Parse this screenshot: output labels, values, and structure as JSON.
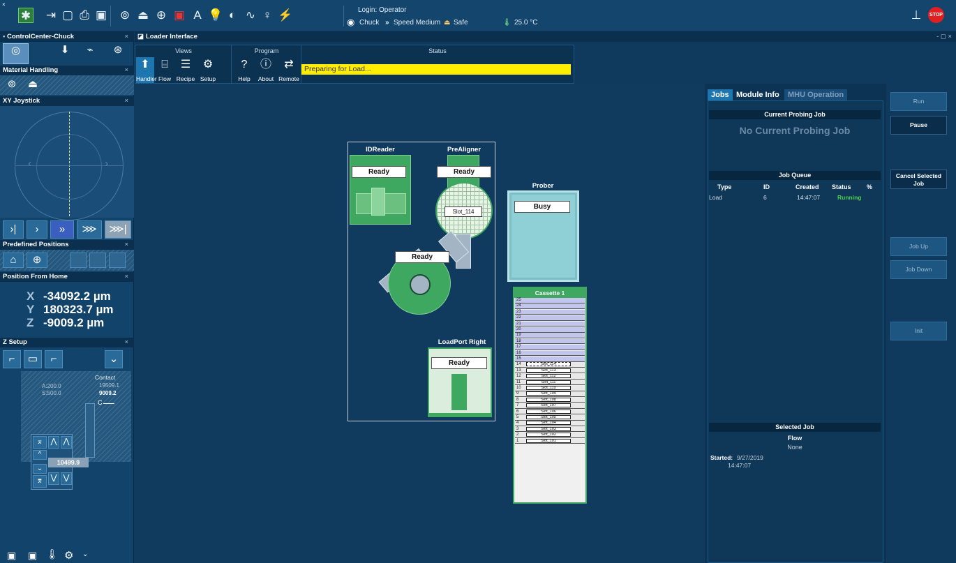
{
  "toolbar": {
    "login": "Login: Operator",
    "chuck": "Chuck",
    "speed": "Speed Medium",
    "safe": "Safe",
    "temp": "25.0 °C",
    "stop": "STOP"
  },
  "left": {
    "control_center": "ControlCenter-Chuck",
    "material_handling": "Material Handling",
    "xy_joystick": "XY Joystick",
    "predefined_positions": "Predefined Positions",
    "position_from_home": "Position From Home",
    "x_label": "X",
    "x_value": "-34092.2 µm",
    "y_label": "Y",
    "y_value": "180323.7 µm",
    "z_label": "Z",
    "z_value": "-9009.2 µm",
    "z_setup": "Z Setup",
    "contact_label": "Contact",
    "contact_val1": "19509.1",
    "contact_val2": "9009.2",
    "a_val": "A:200.0",
    "s_val": "S:500.0",
    "c_label": "C",
    "z_height": "10499.9",
    "close": "×"
  },
  "loader": {
    "title": "Loader Interface",
    "views": "Views",
    "program": "Program",
    "status_title": "Status",
    "handler": "Handler",
    "flow": "Flow",
    "recipe": "Recipe",
    "setup": "Setup",
    "help": "Help",
    "about": "About",
    "remote": "Remote",
    "status_text": "Preparing for Load...",
    "win_controls": "- ◻ ×"
  },
  "canvas": {
    "idreader": "IDReader",
    "idreader_state": "Ready",
    "prealigner": "PreAligner",
    "prealigner_state": "Ready",
    "prealigner_slot": "Slot_114",
    "robot_state": "Ready",
    "prober": "Prober",
    "prober_state": "Busy",
    "loadport": "LoadPort Right",
    "loadport_state": "Ready",
    "cassette": "Cassette 1",
    "empty_rows": [
      "25",
      "24",
      "23",
      "22",
      "21",
      "20",
      "19",
      "18",
      "17",
      "16",
      "15"
    ],
    "slot_rows": [
      {
        "n": "14",
        "s": "Slot_114"
      },
      {
        "n": "13",
        "s": "Slot_113"
      },
      {
        "n": "12",
        "s": "Slot_112"
      },
      {
        "n": "11",
        "s": "Slot_111"
      },
      {
        "n": "10",
        "s": "Slot_110"
      },
      {
        "n": "9",
        "s": "Slot_109"
      },
      {
        "n": "8",
        "s": "Slot_108"
      },
      {
        "n": "7",
        "s": "Slot_107"
      },
      {
        "n": "6",
        "s": "Slot_106"
      },
      {
        "n": "5",
        "s": "Slot_105"
      },
      {
        "n": "4",
        "s": "Slot_104"
      },
      {
        "n": "3",
        "s": "Slot_103"
      },
      {
        "n": "2",
        "s": "Slot_102"
      },
      {
        "n": "1",
        "s": "Slot_101"
      }
    ]
  },
  "jobs": {
    "tab_jobs": "Jobs",
    "tab_module": "Module Info",
    "tab_mhu": "MHU Operation",
    "current_head": "Current Probing Job",
    "no_job": "No Current Probing Job",
    "queue_head": "Job Queue",
    "col_type": "Type",
    "col_id": "ID",
    "col_created": "Created",
    "col_status": "Status",
    "col_pct": "%",
    "row_type": "Load",
    "row_id": "6",
    "row_created": "14:47:07",
    "row_status": "Running",
    "selected_head": "Selected Job",
    "flow_label": "Flow",
    "flow_value": "None",
    "started_label": "Started:",
    "started_date": "9/27/2019",
    "started_time": "14:47:07"
  },
  "side_buttons": {
    "run": "Run",
    "pause": "Pause",
    "cancel": "Cancel Selected Job",
    "job_up": "Job Up",
    "job_down": "Job Down",
    "init": "Init"
  },
  "colors": {
    "background": "#0f3a5e",
    "status_yellow": "#ffee00",
    "module_green": "#3ea760",
    "prober_cyan": "#8fcfd6",
    "running_green": "#4cd04c",
    "stop_red": "#e02020"
  }
}
